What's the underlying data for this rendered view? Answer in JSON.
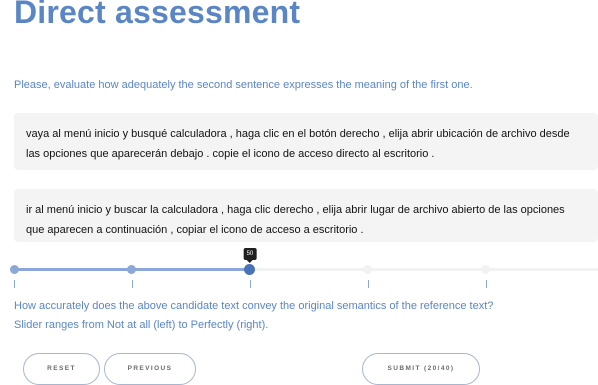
{
  "title": "Direct assessment",
  "instruction": "Please, evaluate how adequately the second sentence expresses the meaning of the first one.",
  "reference_text": "vaya al menú inicio y busqué calculadora , haga clic en el botón derecho , elija abrir ubicación de archivo desde las opciones que aparecerán debajo . copie el icono de acceso directo al escritorio .",
  "candidate_text": "ir al menú inicio y buscar la calculadora , haga clic derecho , elija abrir lugar de archivo abierto de las opciones que aparecen a continuación , copiar el icono de acceso a escritorio .",
  "slider": {
    "value": 50,
    "value_label": "50",
    "min": 0,
    "max": 100
  },
  "question": "How accurately does the above candidate text convey the original semantics of the reference text?",
  "slider_hint": "Slider ranges from Not at all (left) to Perfectly (right).",
  "buttons": {
    "reset": "RESET",
    "previous": "PREVIOUS",
    "submit": "SUBMIT (20/40)"
  },
  "colors": {
    "accent": "#5b86c5",
    "slider_fill": "#8ba8d8",
    "slider_handle": "#4a72b8"
  }
}
